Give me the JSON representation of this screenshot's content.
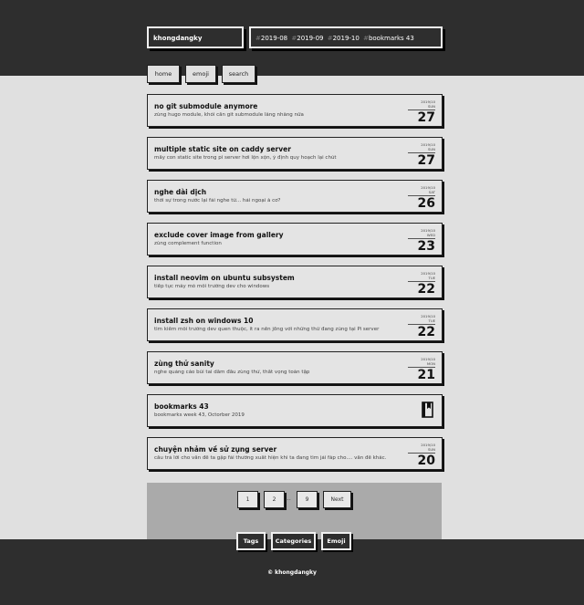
{
  "header": {
    "site_name": "khongdangky",
    "tags": [
      "2019-08",
      "2019-09",
      "2019-10",
      "bookmarks 43"
    ]
  },
  "nav": {
    "home": "home",
    "emoji": "emoji",
    "search": "search"
  },
  "posts": [
    {
      "title": "no git submodule anymore",
      "desc": "zùng hugo module, khỏi cần git submodule lằng nhằng nữa",
      "ym": "2019/10",
      "dow": "SUN",
      "day": "27"
    },
    {
      "title": "multiple static site on caddy server",
      "desc": "mấy con static site trong pi server hơi lộn xộn, ý định quy hoạch lại chút",
      "ym": "2019/10",
      "dow": "SUN",
      "day": "27"
    },
    {
      "title": "nghe dài dịch",
      "desc": "thời sự trong nước lại fải nghe từ... hải ngoại à cơ?",
      "ym": "2019/10",
      "dow": "SAT",
      "day": "26"
    },
    {
      "title": "exclude cover image from gallery",
      "desc": "zùng complement function",
      "ym": "2019/10",
      "dow": "WED",
      "day": "23"
    },
    {
      "title": "install neovim on ubuntu subsystem",
      "desc": "tiếp tục máy mò môi trường dev cho windows",
      "ym": "2019/10",
      "dow": "TUE",
      "day": "22"
    },
    {
      "title": "install zsh on windows 10",
      "desc": "tìm kiếm môi trường dev quen thuộc, ít ra nền jống với những thứ đang zùng tại Pi server",
      "ym": "2019/10",
      "dow": "TUE",
      "day": "22"
    },
    {
      "title": "zùng thử sanity",
      "desc": "nghe quảng cáo bùi tai dâm đầu zùng thử, thất vọng toàn tập",
      "ym": "2019/10",
      "dow": "MON",
      "day": "21"
    },
    {
      "title": "bookmarks 43",
      "desc": "bookmarks week 43, Octorber 2019",
      "bookmark": true
    },
    {
      "title": "chuyện nhảm về sử zụng server",
      "desc": "câu trả lời cho vấn đề ta gặp fải thường xuất hiện khi ta đang tìm jải fáp cho.... vấn đề khác.",
      "ym": "2019/10",
      "dow": "SUN",
      "day": "20"
    }
  ],
  "pagination": {
    "p1": "1",
    "p2": "2",
    "ellipsis": "...",
    "p9": "9",
    "next": "Next"
  },
  "footer": {
    "tags": "Tags",
    "categories": "Categories",
    "emoji": "Emoji",
    "copyright": "© khongdangky"
  },
  "colors": {
    "header_bg": "#2e2e2e",
    "page_bg": "#e0e0e0",
    "pagination_bg": "#aaaaaa"
  }
}
